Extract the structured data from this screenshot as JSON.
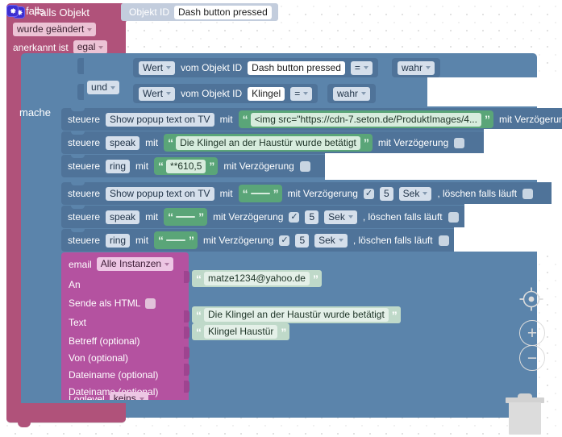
{
  "trigger": {
    "icon": "gear-icon",
    "title": "Falls Objekt",
    "change_mode": "wurde geändert",
    "ack_label": "anerkannt ist",
    "ack_value": "egal",
    "objekt_id_label": "Objekt ID",
    "objekt_id_value": "Dash button pressed"
  },
  "if_block": {
    "icon": "gear-icon",
    "title": "falls",
    "do_label": "mache",
    "operator": "und",
    "conditions": [
      {
        "value_label": "Wert",
        "from_label": "vom Objekt ID",
        "object_id": "Dash button pressed",
        "comparator": "=",
        "compare_value": "wahr"
      },
      {
        "value_label": "Wert",
        "from_label": "vom Objekt ID",
        "object_id": "Klingel",
        "comparator": "=",
        "compare_value": "wahr"
      }
    ]
  },
  "statements": [
    {
      "verb": "steuere",
      "target": "Show popup text on TV",
      "with_label": "mit",
      "string_value": "<img src=\"https://cdn-7.seton.de/ProduktImages/4...",
      "delay_label": "mit Verzögerung",
      "delay_checked": false,
      "delay_value": "",
      "delay_unit": "",
      "clear_label": "",
      "clear_checked": false,
      "truncated": true
    },
    {
      "verb": "steuere",
      "target": "speak",
      "with_label": "mit",
      "string_value": "Die Klingel an der Haustür wurde betätigt",
      "delay_label": "mit Verzögerung",
      "delay_checked": false,
      "delay_value": "",
      "delay_unit": "",
      "clear_label": "",
      "clear_checked": false,
      "truncated": false
    },
    {
      "verb": "steuere",
      "target": "ring",
      "with_label": "mit",
      "string_value": "**610,5",
      "delay_label": "mit Verzögerung",
      "delay_checked": false,
      "delay_value": "",
      "delay_unit": "",
      "clear_label": "",
      "clear_checked": false,
      "truncated": false
    },
    {
      "verb": "steuere",
      "target": "Show popup text on TV",
      "with_label": "mit",
      "string_value": "",
      "delay_label": "mit Verzögerung",
      "delay_checked": true,
      "delay_value": "5",
      "delay_unit": "Sek",
      "clear_label": ", löschen falls läuft",
      "clear_checked": false,
      "truncated": false
    },
    {
      "verb": "steuere",
      "target": "speak",
      "with_label": "mit",
      "string_value": "",
      "delay_label": "mit Verzögerung",
      "delay_checked": true,
      "delay_value": "5",
      "delay_unit": "Sek",
      "clear_label": ", löschen falls läuft",
      "clear_checked": false,
      "truncated": false
    },
    {
      "verb": "steuere",
      "target": "ring",
      "with_label": "mit",
      "string_value": "",
      "delay_label": "mit Verzögerung",
      "delay_checked": true,
      "delay_value": "5",
      "delay_unit": "Sek",
      "clear_label": ", löschen falls läuft",
      "clear_checked": false,
      "truncated": false
    }
  ],
  "email": {
    "title": "email",
    "instance": "Alle Instanzen",
    "fields": [
      {
        "label": "An",
        "value": "matze1234@yahoo.de",
        "type": "string"
      },
      {
        "label": "Sende als HTML",
        "value": "",
        "type": "checkbox"
      },
      {
        "label": "Text",
        "value": "Die Klingel an der Haustür wurde betätigt",
        "type": "string"
      },
      {
        "label": "Betreff (optional)",
        "value": "Klingel Haustür",
        "type": "string"
      },
      {
        "label": "Von (optional)",
        "value": "",
        "type": "empty"
      },
      {
        "label": "Dateiname (optional)",
        "value": "",
        "type": "empty"
      },
      {
        "label": "Dateiname (optional)",
        "value": "",
        "type": "empty"
      },
      {
        "label": "Loglevel",
        "value": "keins",
        "type": "dropdown"
      }
    ]
  },
  "workspace_controls": {
    "center_icon": "crosshair-target-icon",
    "zoom_in": "+",
    "zoom_out": "−",
    "trash_icon": "trash-can-icon"
  },
  "colors": {
    "trigger_block": "#b0527a",
    "if_block": "#5b84ab",
    "statement_row": "#4f7399",
    "string_block": "#5aa578",
    "email_block": "#b452a0",
    "objid_block": "#c3cddd",
    "canvas": "#ffffff"
  }
}
